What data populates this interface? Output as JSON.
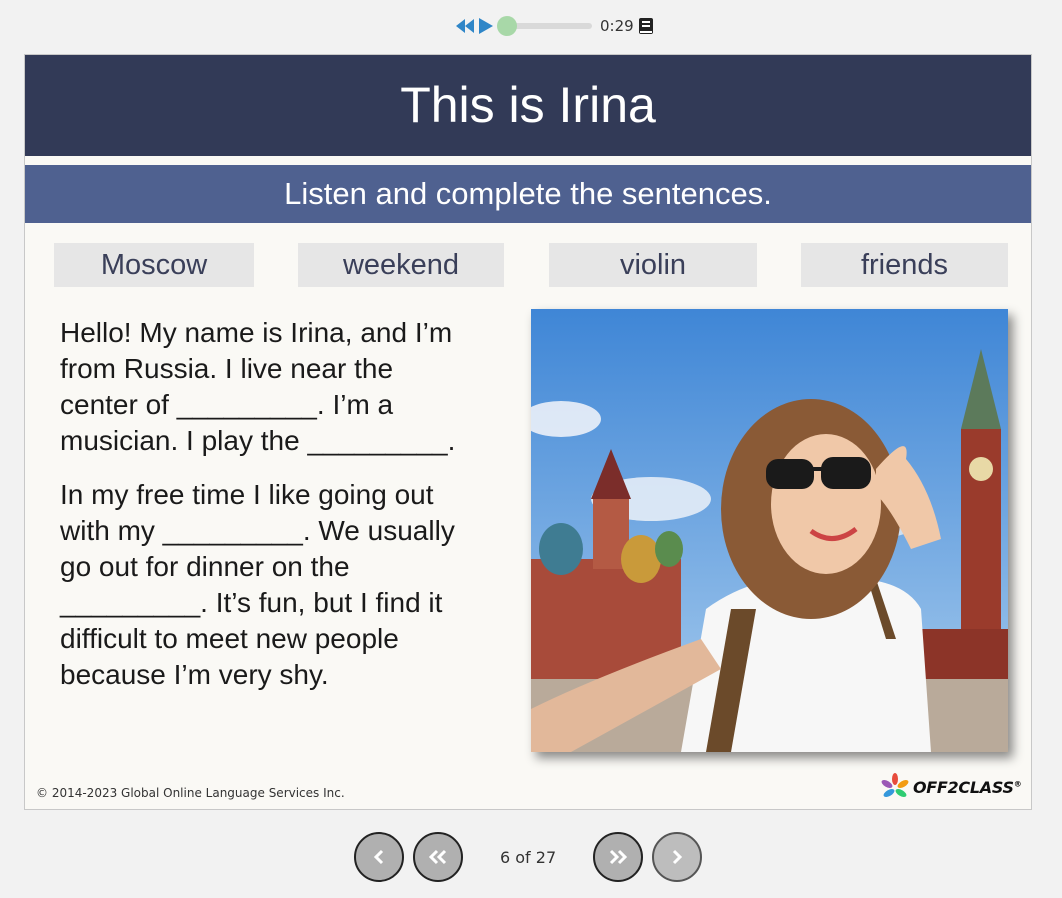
{
  "audio": {
    "time": "0:29",
    "progress": 0.05,
    "rewind_icon": "rewind-icon",
    "play_icon": "play-icon",
    "transcript_icon": "book-icon"
  },
  "slide": {
    "title": "This is Irina",
    "instruction": "Listen and complete the sentences.",
    "word_bank": [
      "Moscow",
      "weekend",
      "violin",
      "friends"
    ],
    "paragraphs": [
      [
        "Hello! My name is Irina, and I’m",
        "from Russia. I live near the",
        "center of _________. I’m a",
        "musician. I play the _________."
      ],
      [
        "In my free time I like going out",
        "with my _________.  We usually",
        "go out for dinner on the",
        "_________. It’s fun, but I find it",
        "difficult to meet new people",
        "because I’m very shy."
      ]
    ],
    "photo_description": "photo",
    "copyright": "© 2014-2023 Global Online Language Services Inc.",
    "logo_text": "OFF2CLASS",
    "logo_mark": "®"
  },
  "nav": {
    "page_count": "6 of 27",
    "prev_icon": "chevron-left-icon",
    "first_icon": "double-chevron-left-icon",
    "last_icon": "double-chevron-right-icon",
    "next_icon": "chevron-right-icon"
  },
  "colors": {
    "title_bg": "#323a57",
    "subtitle_bg": "#4f6190",
    "word_bg": "#e6e6e6",
    "audio_blue": "#2f86c8",
    "progress_knob": "#a8d8a8"
  }
}
